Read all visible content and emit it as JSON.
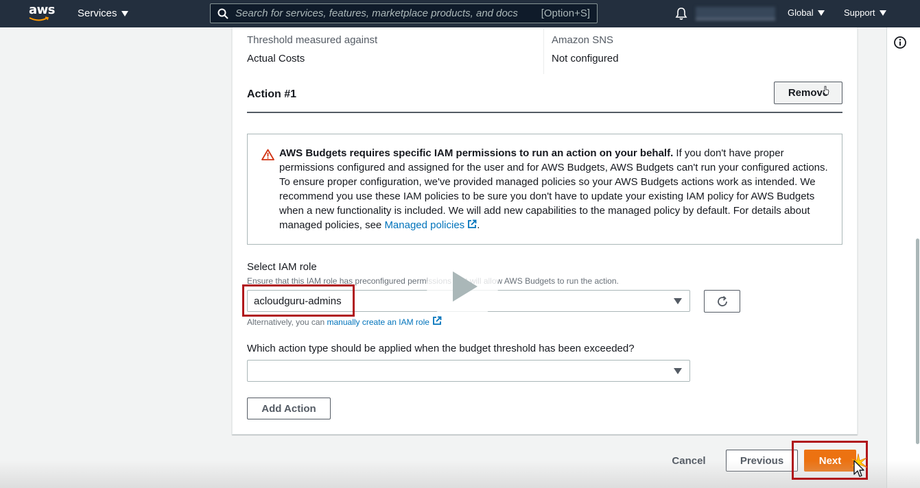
{
  "nav": {
    "logo": "aws",
    "services": "Services",
    "search_placeholder": "Search for services, features, marketplace products, and docs",
    "search_shortcut": "[Option+S]",
    "global": "Global",
    "support": "Support"
  },
  "details": {
    "threshold_label": "Threshold measured against",
    "threshold_value": "Actual Costs",
    "sns_label": "Amazon SNS",
    "sns_value": "Not configured"
  },
  "action": {
    "title": "Action #1",
    "remove_label": "Remove",
    "alert_bold": "AWS Budgets requires specific IAM permissions to run an action on your behalf.",
    "alert_body": " If you don't have proper permissions configured and assigned for the user and for AWS Budgets, AWS Budgets can't run your configured actions. To ensure proper configuration, we've provided managed policies so your AWS Budgets actions work as intended. We recommend you use these IAM policies to be sure you don't have to update your existing IAM policy for AWS Budgets when a new functionality is included. We will add new capabilities to the managed policy by default. For details about managed policies, see ",
    "alert_link": "Managed policies",
    "alert_end": ".",
    "iam_label": "Select IAM role",
    "iam_desc": "Ensure that this IAM role has preconfigured permissions that will allow AWS Budgets to run the action.",
    "iam_value": "acloudguru-admins",
    "alt_prefix": "Alternatively, you can ",
    "alt_link": "manually create an IAM role",
    "type_label": "Which action type should be applied when the budget threshold has been exceeded?",
    "type_value": "",
    "add_action_label": "Add Action"
  },
  "footer": {
    "cancel": "Cancel",
    "previous": "Previous",
    "next": "Next"
  },
  "colors": {
    "nav_bg": "#232f3e",
    "primary": "#ec7211",
    "link": "#0073bb",
    "highlight": "#b0151b",
    "warning": "#d13212"
  }
}
